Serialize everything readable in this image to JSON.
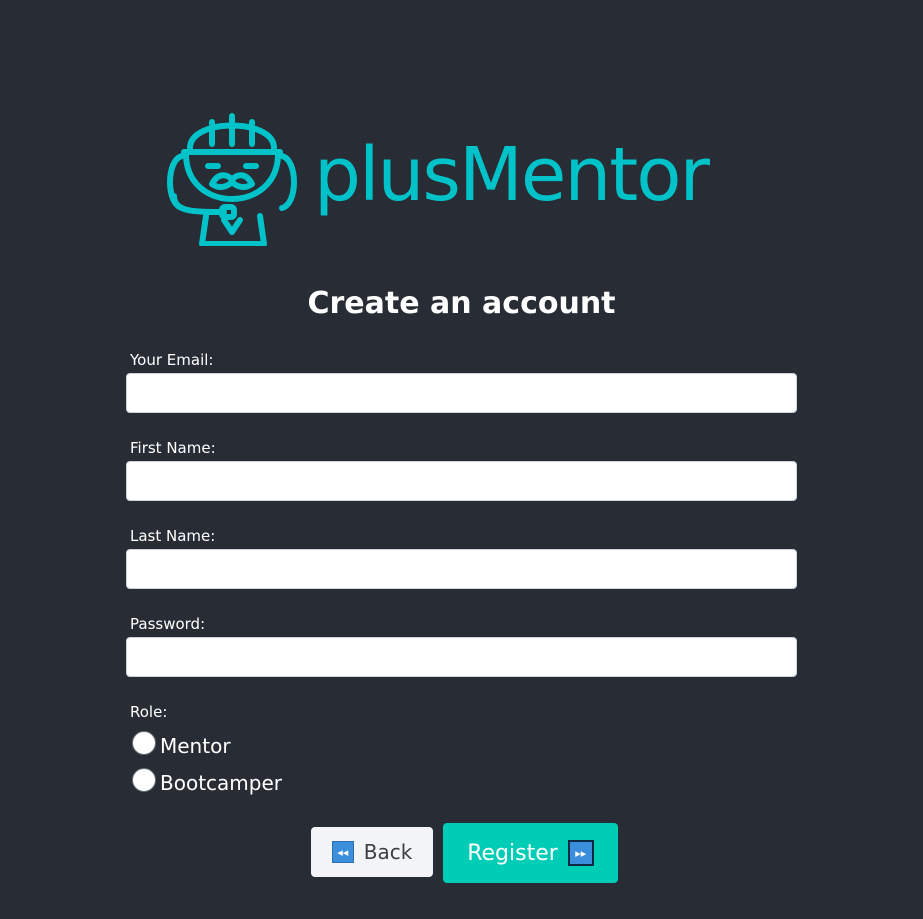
{
  "brand": {
    "name": "plusMentor",
    "color": "#00c3c9",
    "logo_icon": "mentor-mascot-icon"
  },
  "form": {
    "title": "Create an account",
    "fields": [
      {
        "label": "Your Email:",
        "value": "",
        "placeholder": ""
      },
      {
        "label": "First Name:",
        "value": "",
        "placeholder": ""
      },
      {
        "label": "Last Name:",
        "value": "",
        "placeholder": ""
      },
      {
        "label": "Password:",
        "value": "",
        "placeholder": ""
      }
    ],
    "role": {
      "label": "Role:",
      "options": [
        "Mentor",
        "Bootcamper"
      ],
      "selected": null
    }
  },
  "buttons": {
    "back": {
      "label": "Back",
      "icon": "rewind-icon",
      "icon_glyph": "◂◂",
      "color": "#f3f4f5"
    },
    "register": {
      "label": "Register",
      "icon": "fast-forward-icon",
      "icon_glyph": "▸▸",
      "color": "#00cdb5"
    }
  },
  "colors": {
    "background": "#282c34"
  }
}
